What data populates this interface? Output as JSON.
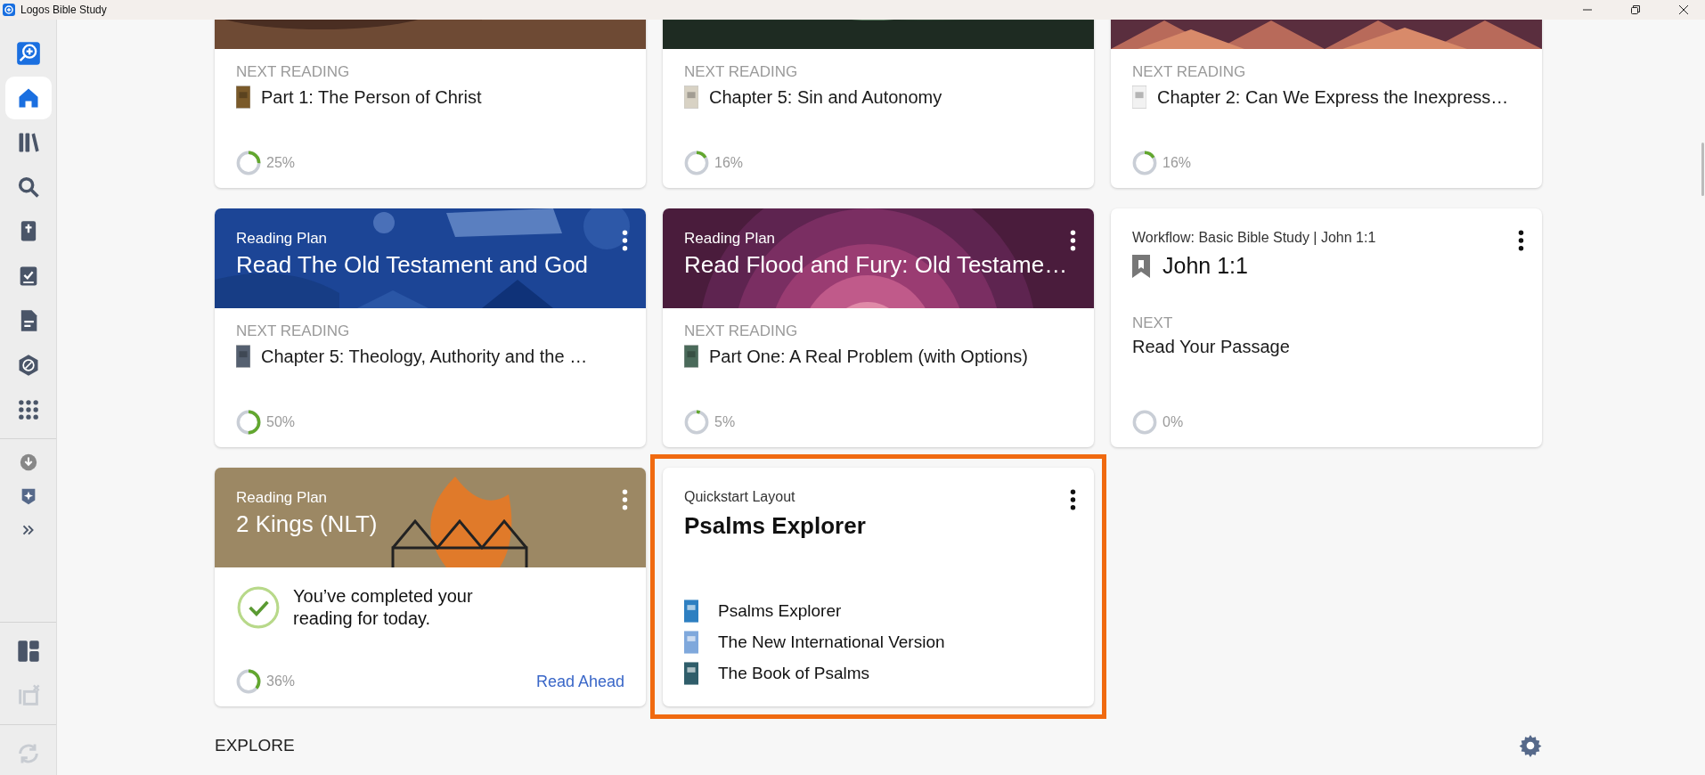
{
  "window": {
    "title": "Logos Bible Study"
  },
  "sidebar": {
    "items": [
      {
        "selected": false
      },
      {
        "selected": true
      },
      {
        "selected": false
      },
      {
        "selected": false
      },
      {
        "selected": false
      },
      {
        "selected": false
      },
      {
        "selected": false
      },
      {
        "selected": false
      },
      {
        "selected": false
      }
    ],
    "bottom": [
      {
        "disabled": false
      },
      {
        "disabled": true
      },
      {
        "disabled": true
      }
    ]
  },
  "cards": [
    {
      "kind": "reading",
      "next_label": "NEXT READING",
      "next": "Part 1: The Person of Christ",
      "progress": {
        "level": 0.25,
        "reading": "25%"
      }
    },
    {
      "kind": "reading",
      "next_label": "NEXT READING",
      "next": "Chapter 5: Sin and Autonomy",
      "progress": {
        "level": 0.16,
        "reading": "16%"
      }
    },
    {
      "kind": "reading",
      "next_label": "NEXT READING",
      "next": "Chapter 2: Can We Express the Inexpress…",
      "progress": {
        "level": 0.16,
        "reading": "16%"
      }
    },
    {
      "kind": "reading",
      "header": {
        "kind": "picture",
        "label": "Reading Plan",
        "title": "Read The Old Testament and God"
      },
      "next_label": "NEXT READING",
      "next": "Chapter 5: Theology, Authority and the …",
      "progress": {
        "level": 0.5,
        "reading": "50%"
      }
    },
    {
      "kind": "reading",
      "header": {
        "kind": "picture",
        "label": "Reading Plan",
        "title": "Read Flood and Fury: Old Testame…"
      },
      "next_label": "NEXT READING",
      "next": "Part One: A Real Problem (with Options)",
      "progress": {
        "level": 0.05,
        "reading": "5%"
      }
    },
    {
      "kind": "workflow",
      "label": "Workflow: Basic Bible Study | John 1:1",
      "title": "John 1:1",
      "next_label": "NEXT",
      "next": "Read Your Passage",
      "progress": {
        "level": 0,
        "reading": "0%"
      }
    },
    {
      "kind": "completed",
      "header": {
        "kind": "picture",
        "label": "Reading Plan",
        "title": "2 Kings (NLT)"
      },
      "message": "You’ve completed your reading for today.",
      "progress": {
        "level": 0.36,
        "reading": "36%"
      },
      "link": "Read Ahead"
    },
    {
      "kind": "quickstart",
      "highlighted": true,
      "label": "Quickstart Layout",
      "title": "Psalms Explorer",
      "resources": [
        "Psalms Explorer",
        "The New International Version",
        "The Book of Psalms"
      ]
    }
  ],
  "section": {
    "title": "EXPLORE"
  }
}
